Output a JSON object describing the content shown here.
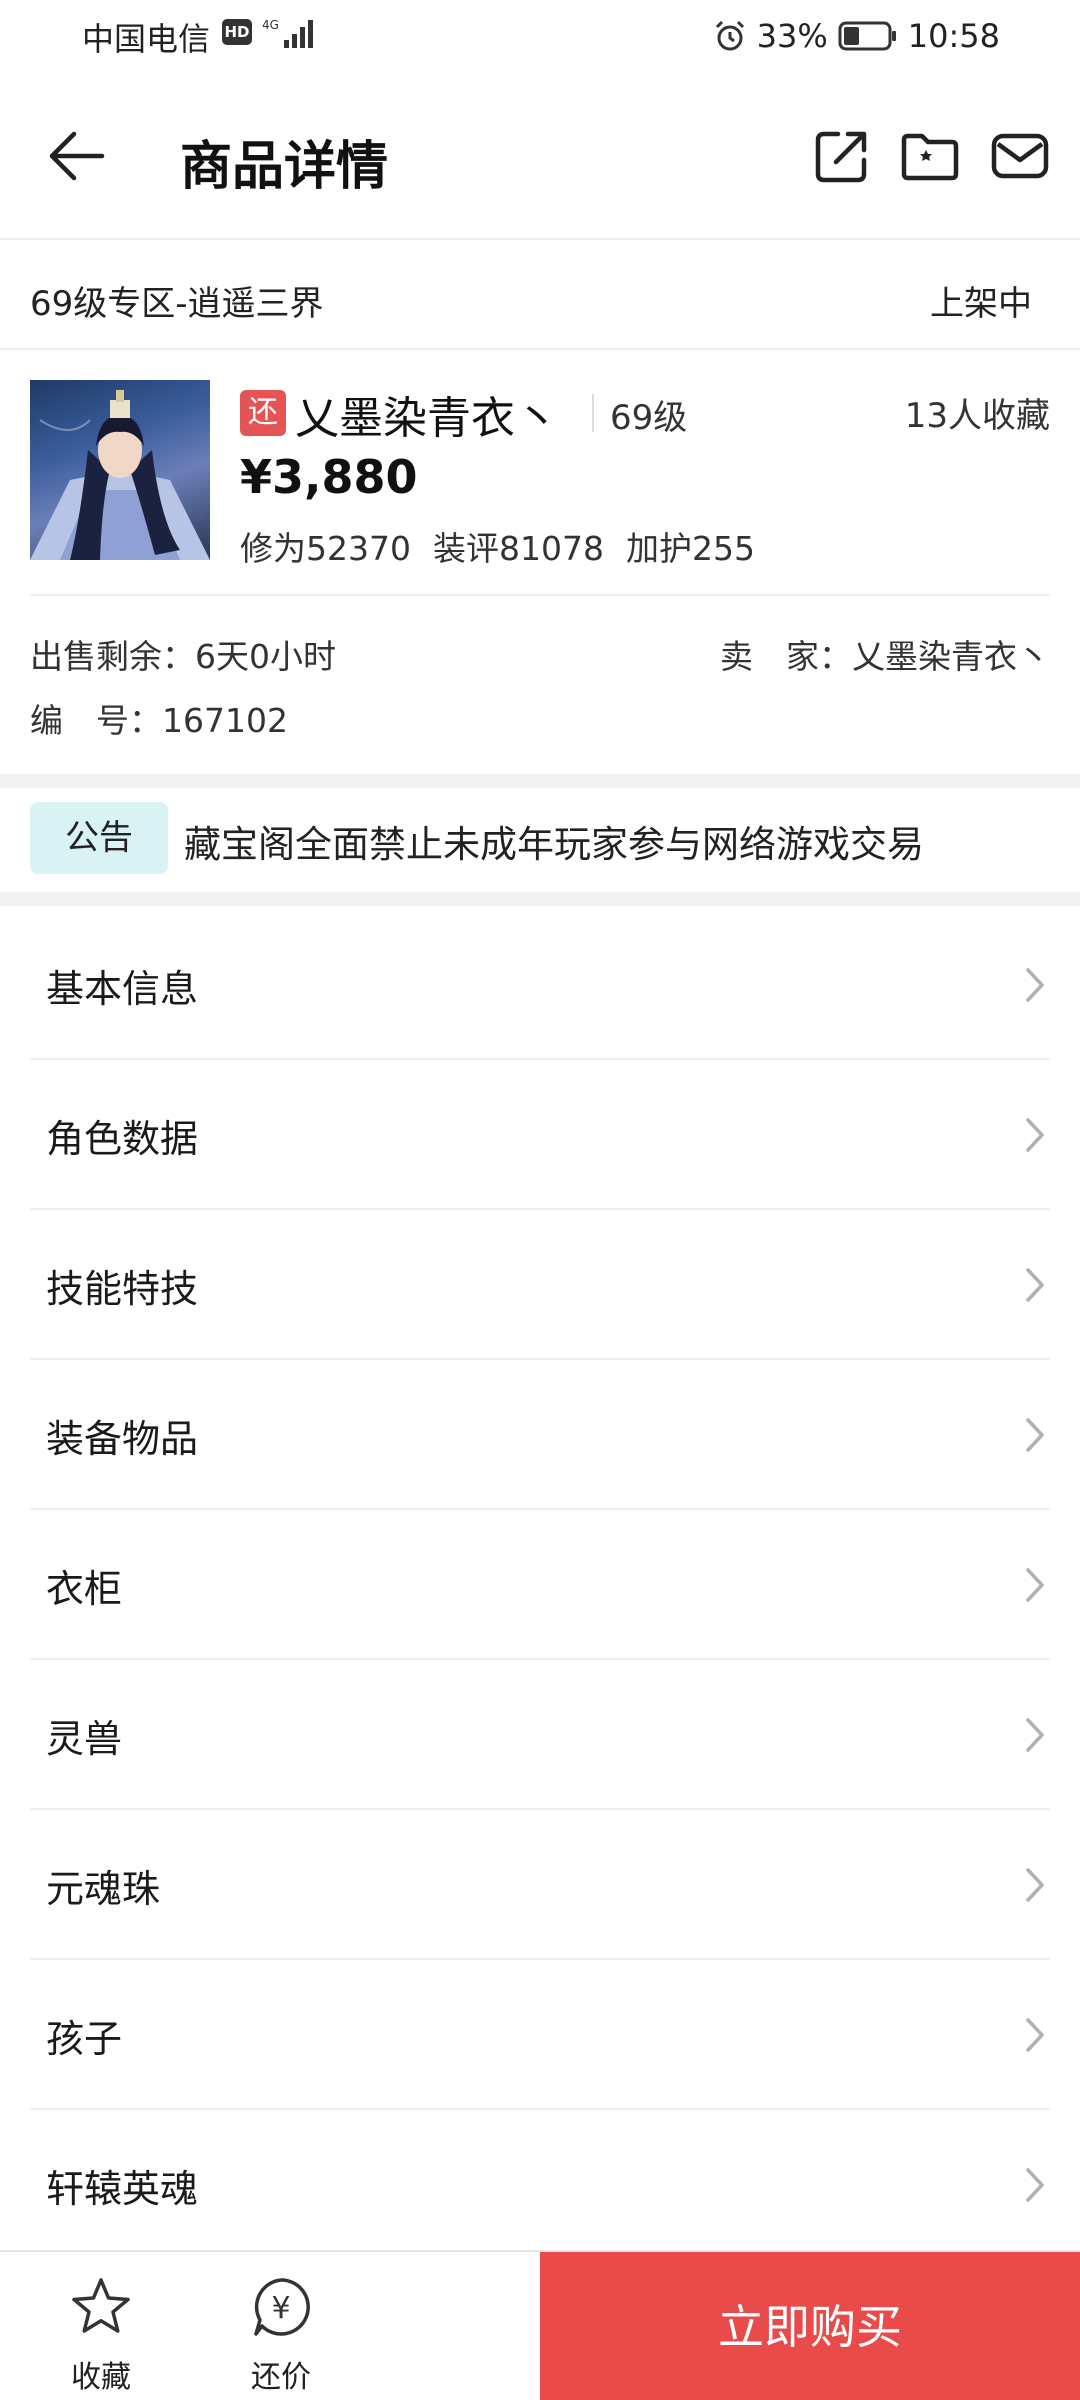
{
  "status_bar": {
    "carrier": "中国电信",
    "hd": "HD",
    "network": "4G",
    "battery": "33%",
    "time": "10:58"
  },
  "header": {
    "title": "商品详情",
    "icons": [
      "back-arrow-icon",
      "share-icon",
      "folder-star-icon",
      "mail-icon"
    ]
  },
  "zone": {
    "name": "69级专区-逍遥三界",
    "status": "上架中"
  },
  "product": {
    "badge": "还",
    "seller_name": "乂墨染青衣丶",
    "level": "69级",
    "favorites": "13人收藏",
    "price": "¥3,880",
    "stats": [
      "修为52370",
      "装评81078",
      "加护255"
    ]
  },
  "info": {
    "remaining": "出售剩余：6天0小时",
    "seller": "卖　家：乂墨染青衣丶",
    "number": "编　号：167102"
  },
  "notice": {
    "tag": "公告",
    "text": "藏宝阁全面禁止未成年玩家参与网络游戏交易"
  },
  "menu": {
    "items": [
      "基本信息",
      "角色数据",
      "技能特技",
      "装备物品",
      "衣柜",
      "灵兽",
      "元魂珠",
      "孩子",
      "轩辕英魂"
    ]
  },
  "bottom_bar": {
    "favorite_label": "收藏",
    "bargain_label": "还价",
    "bargain_symbol": "¥",
    "buy_label": "立即购买"
  },
  "colors": {
    "accent_red": "#e94b4b",
    "badge_red": "#e55454",
    "notice_bg": "#d9f3f5"
  }
}
